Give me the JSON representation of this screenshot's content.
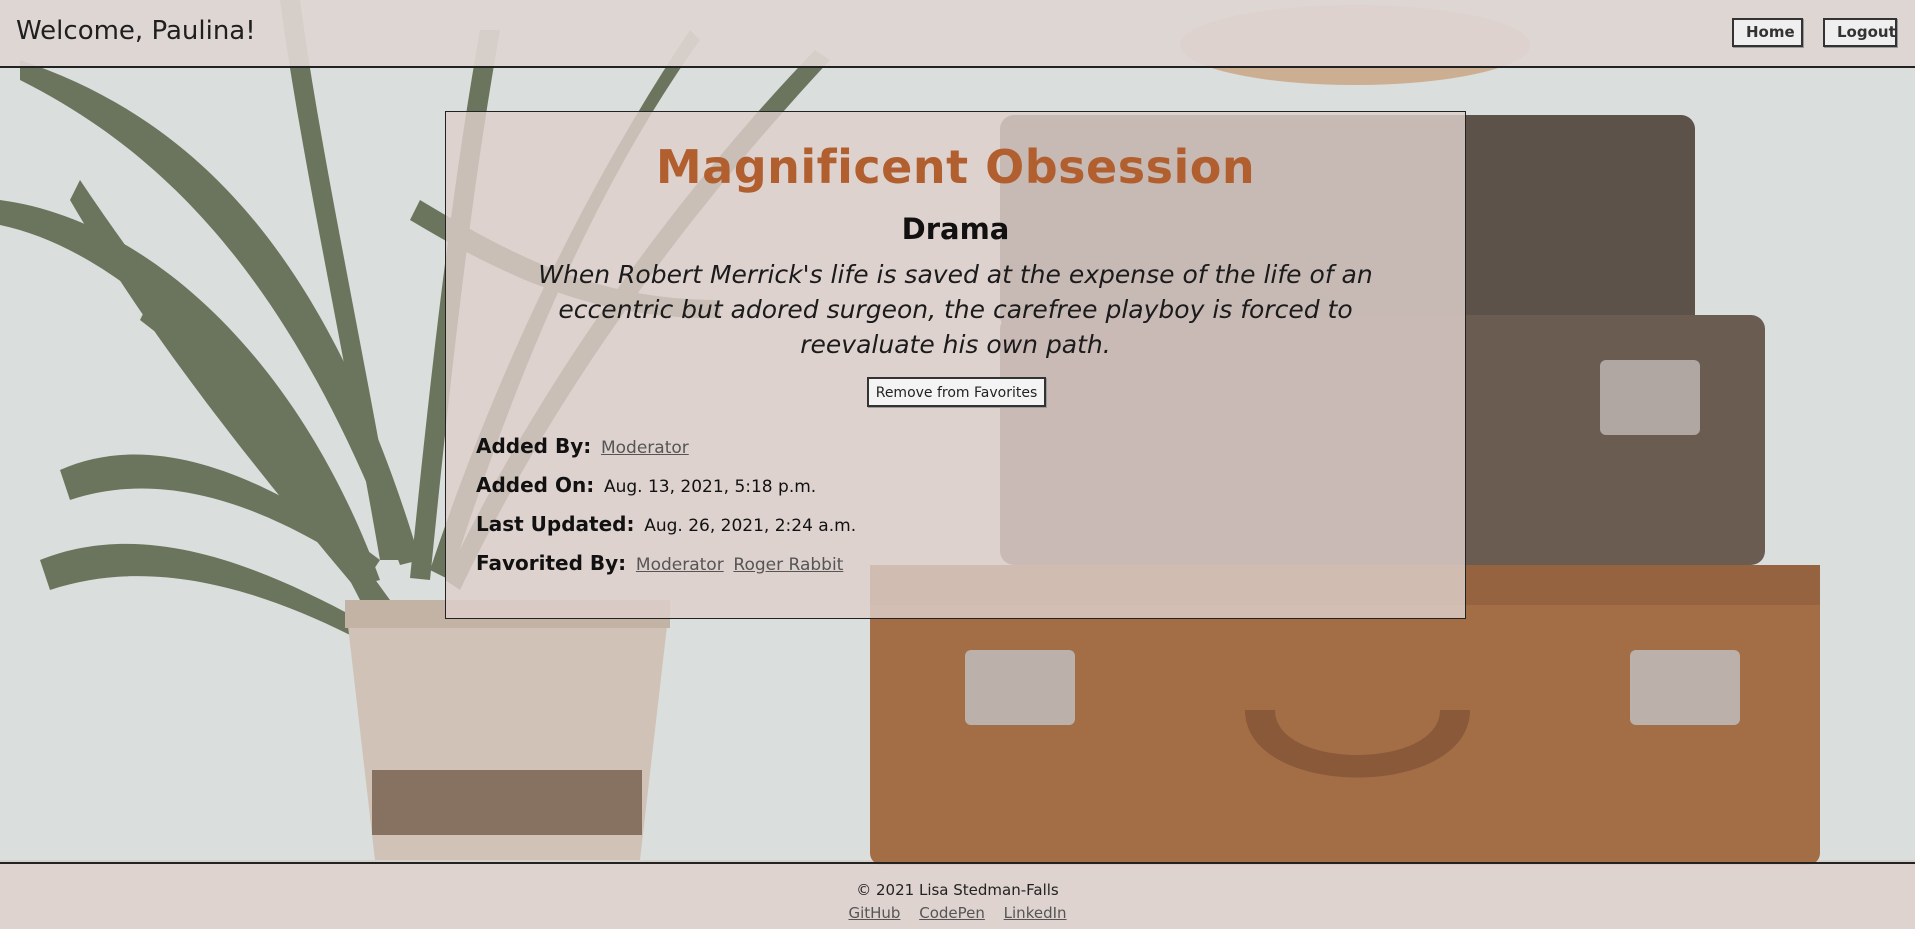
{
  "header": {
    "welcome_text": "Welcome, Paulina!",
    "home_label": "Home",
    "logout_label": "Logout"
  },
  "movie": {
    "title": "Magnificent Obsession",
    "genre": "Drama",
    "description": "When Robert Merrick's life is saved at the expense of the life of an eccentric but adored surgeon, the carefree playboy is forced to reevaluate his own path.",
    "favorite_button_label": "Remove from Favorites",
    "added_by_label": "Added By:",
    "added_by_user": "Moderator",
    "added_on_label": "Added On:",
    "added_on_value": "Aug. 13, 2021, 5:18 p.m.",
    "last_updated_label": "Last Updated:",
    "last_updated_value": "Aug. 26, 2021, 2:24 a.m.",
    "favorited_by_label": "Favorited By:",
    "favorited_by_users": [
      "Moderator",
      "Roger Rabbit"
    ]
  },
  "footer": {
    "copyright": "© 2021 Lisa Stedman-Falls",
    "links": [
      "GitHub",
      "CodePen",
      "LinkedIn"
    ]
  },
  "colors": {
    "title_accent": "#b25f30",
    "header_bg": "#ded5d2",
    "card_bg": "#ded0cc"
  }
}
